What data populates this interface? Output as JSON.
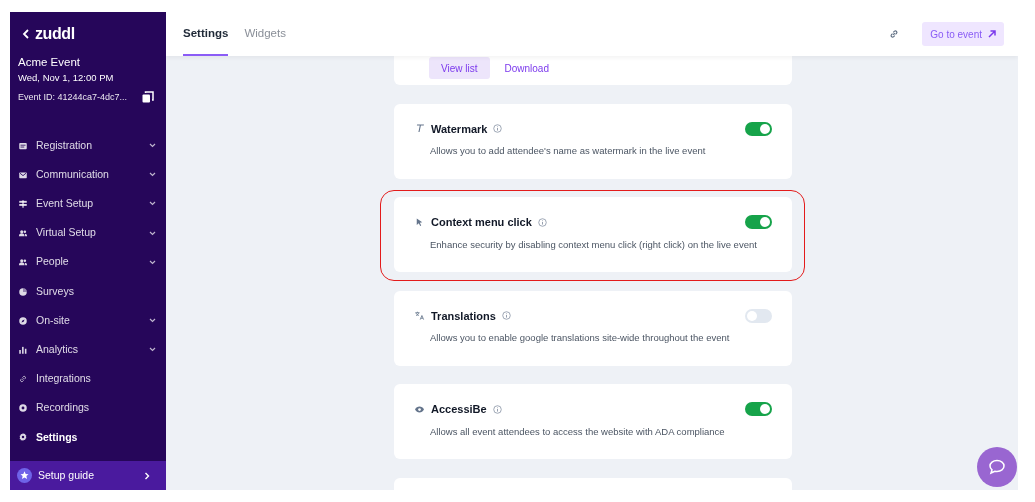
{
  "sidebar": {
    "brand": "zuddl",
    "event_name": "Acme Event",
    "event_date": "Wed, Nov 1, 12:00 PM",
    "event_id": "Event ID: 41244ca7-4dc7...",
    "items": [
      {
        "label": "Registration",
        "expandable": true,
        "selected": false
      },
      {
        "label": "Communication",
        "expandable": true,
        "selected": false
      },
      {
        "label": "Event Setup",
        "expandable": true,
        "selected": false
      },
      {
        "label": "Virtual Setup",
        "expandable": true,
        "selected": false
      },
      {
        "label": "People",
        "expandable": true,
        "selected": false
      },
      {
        "label": "Surveys",
        "expandable": false,
        "selected": false
      },
      {
        "label": "On-site",
        "expandable": true,
        "selected": false
      },
      {
        "label": "Analytics",
        "expandable": true,
        "selected": false
      },
      {
        "label": "Integrations",
        "expandable": false,
        "selected": false
      },
      {
        "label": "Recordings",
        "expandable": false,
        "selected": false
      },
      {
        "label": "Settings",
        "expandable": false,
        "selected": true
      }
    ],
    "setup_guide": "Setup guide"
  },
  "tabs": [
    {
      "label": "Settings",
      "selected": true
    },
    {
      "label": "Widgets",
      "selected": false
    }
  ],
  "go_to_event": "Go to event",
  "top_card": {
    "buttons": [
      "View list",
      "Download"
    ]
  },
  "settings": [
    {
      "title": "Watermark",
      "description": "Allows you to add attendee's name as watermark in the live event",
      "on": true,
      "highlighted": false
    },
    {
      "title": "Context menu click",
      "description": "Enhance security by disabling context menu click (right click) on the live event",
      "on": true,
      "highlighted": true
    },
    {
      "title": "Translations",
      "description": "Allows you to enable google translations site-wide throughout the event",
      "on": false,
      "highlighted": false
    },
    {
      "title": "AccessiBe",
      "description": "Allows all event attendees to access the website with ADA compliance",
      "on": true,
      "highlighted": false
    }
  ]
}
